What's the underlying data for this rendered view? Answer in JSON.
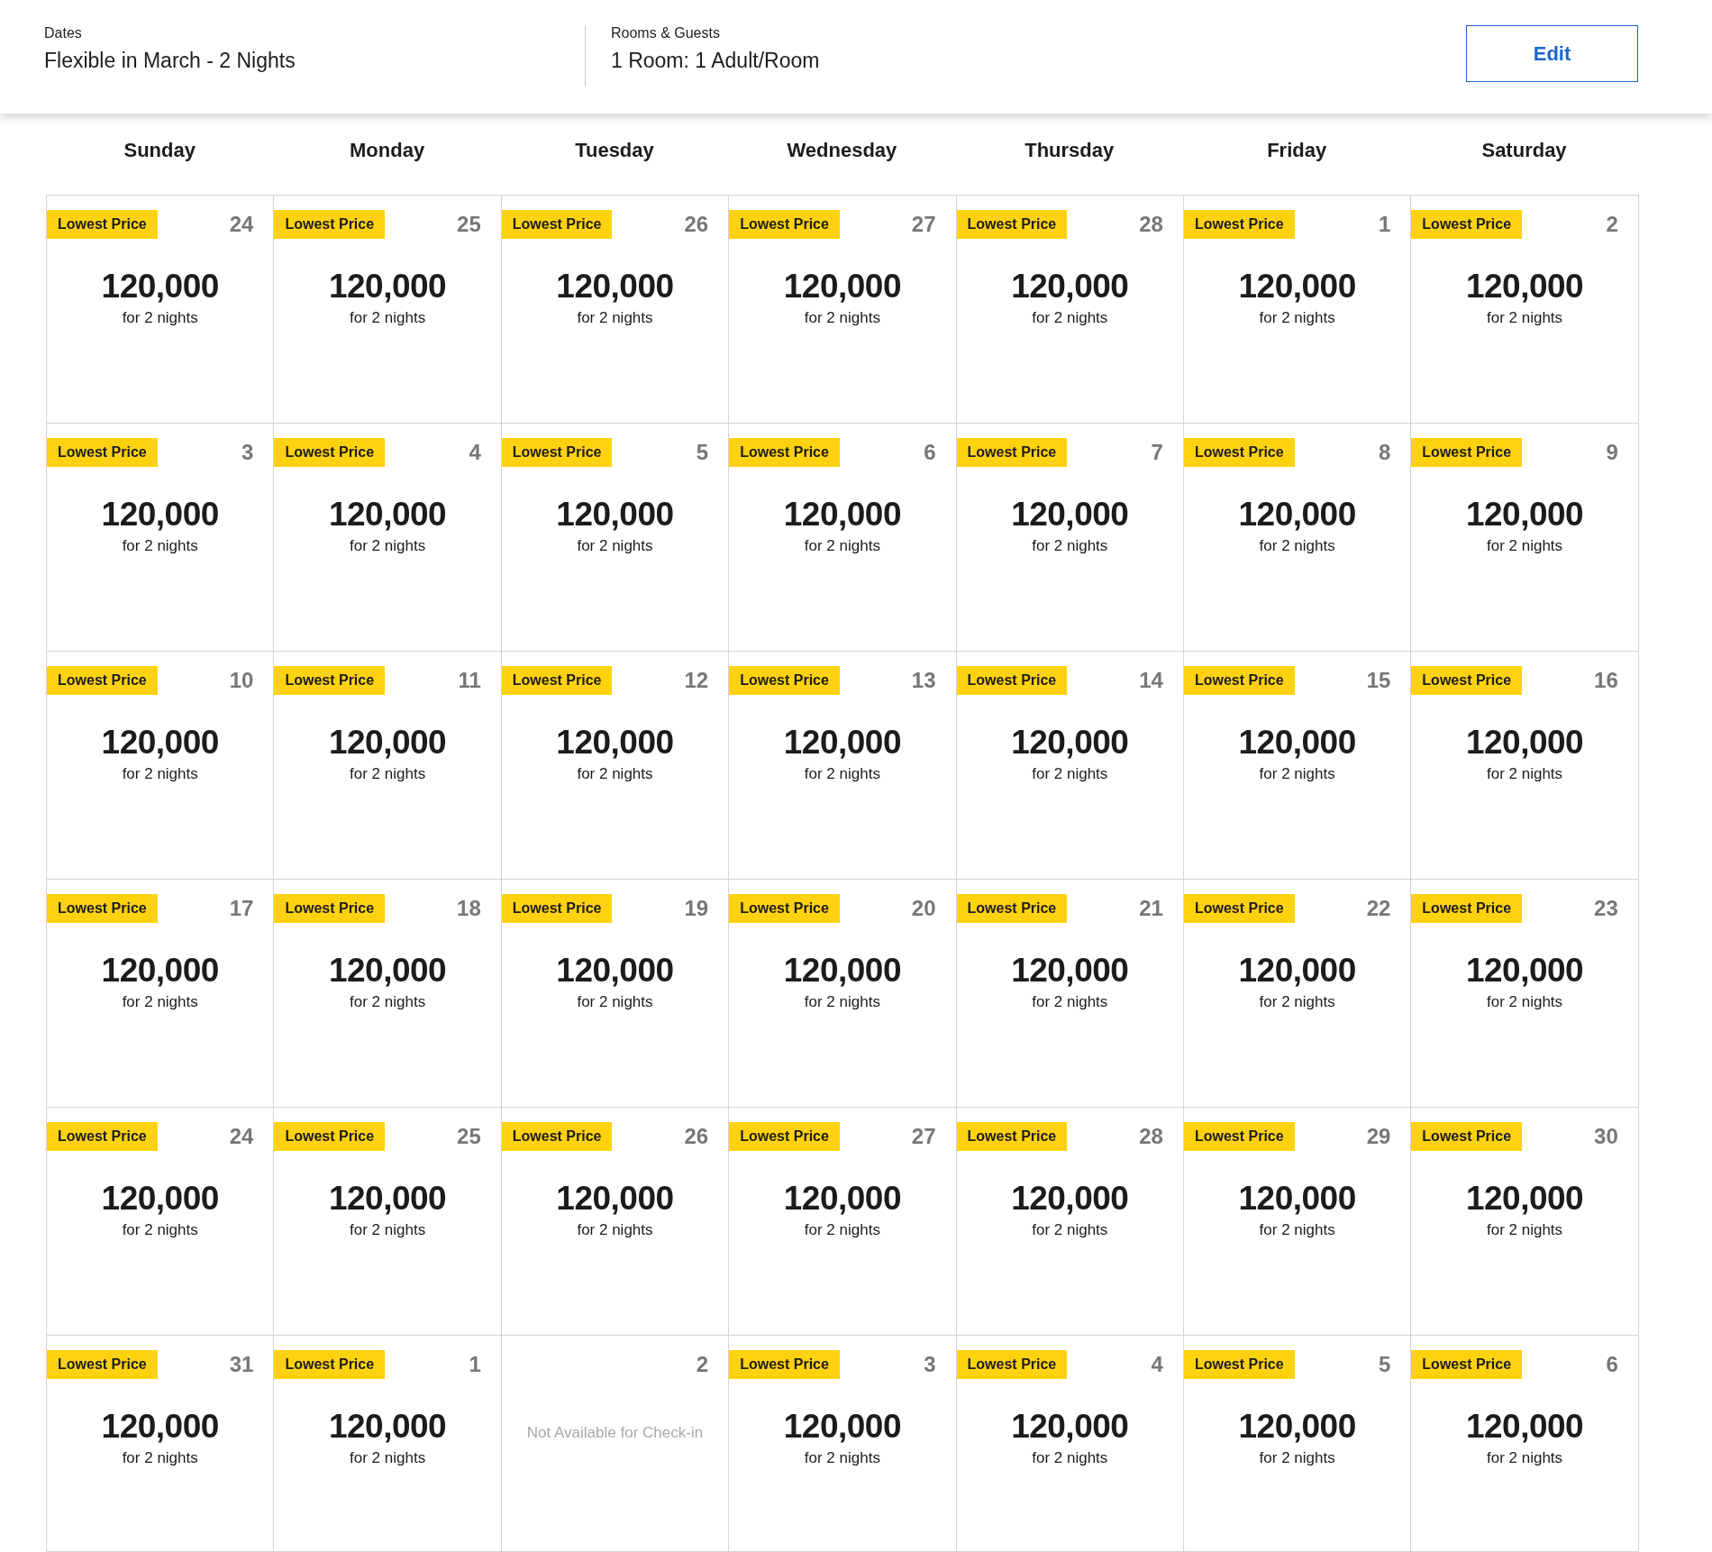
{
  "search_summary": [
    {
      "label": "Dates",
      "value": "Flexible in March - 2 Nights"
    },
    {
      "label": "Rooms & Guests",
      "value": "1 Room: 1 Adult/Room"
    }
  ],
  "edit_button": "Edit",
  "weekdays": [
    "Sunday",
    "Monday",
    "Tuesday",
    "Wednesday",
    "Thursday",
    "Friday",
    "Saturday"
  ],
  "days": [
    {
      "kind": "price",
      "badge": "Lowest Price",
      "date": "24",
      "price": "120,000",
      "nights": "for 2 nights"
    },
    {
      "kind": "price",
      "badge": "Lowest Price",
      "date": "25",
      "price": "120,000",
      "nights": "for 2 nights"
    },
    {
      "kind": "price",
      "badge": "Lowest Price",
      "date": "26",
      "price": "120,000",
      "nights": "for 2 nights"
    },
    {
      "kind": "price",
      "badge": "Lowest Price",
      "date": "27",
      "price": "120,000",
      "nights": "for 2 nights"
    },
    {
      "kind": "price",
      "badge": "Lowest Price",
      "date": "28",
      "price": "120,000",
      "nights": "for 2 nights"
    },
    {
      "kind": "price",
      "badge": "Lowest Price",
      "date": "1",
      "price": "120,000",
      "nights": "for 2 nights"
    },
    {
      "kind": "price",
      "badge": "Lowest Price",
      "date": "2",
      "price": "120,000",
      "nights": "for 2 nights"
    },
    {
      "kind": "price",
      "badge": "Lowest Price",
      "date": "3",
      "price": "120,000",
      "nights": "for 2 nights"
    },
    {
      "kind": "price",
      "badge": "Lowest Price",
      "date": "4",
      "price": "120,000",
      "nights": "for 2 nights"
    },
    {
      "kind": "price",
      "badge": "Lowest Price",
      "date": "5",
      "price": "120,000",
      "nights": "for 2 nights"
    },
    {
      "kind": "price",
      "badge": "Lowest Price",
      "date": "6",
      "price": "120,000",
      "nights": "for 2 nights"
    },
    {
      "kind": "price",
      "badge": "Lowest Price",
      "date": "7",
      "price": "120,000",
      "nights": "for 2 nights"
    },
    {
      "kind": "price",
      "badge": "Lowest Price",
      "date": "8",
      "price": "120,000",
      "nights": "for 2 nights"
    },
    {
      "kind": "price",
      "badge": "Lowest Price",
      "date": "9",
      "price": "120,000",
      "nights": "for 2 nights"
    },
    {
      "kind": "price",
      "badge": "Lowest Price",
      "date": "10",
      "price": "120,000",
      "nights": "for 2 nights"
    },
    {
      "kind": "price",
      "badge": "Lowest Price",
      "date": "11",
      "price": "120,000",
      "nights": "for 2 nights"
    },
    {
      "kind": "price",
      "badge": "Lowest Price",
      "date": "12",
      "price": "120,000",
      "nights": "for 2 nights"
    },
    {
      "kind": "price",
      "badge": "Lowest Price",
      "date": "13",
      "price": "120,000",
      "nights": "for 2 nights"
    },
    {
      "kind": "price",
      "badge": "Lowest Price",
      "date": "14",
      "price": "120,000",
      "nights": "for 2 nights"
    },
    {
      "kind": "price",
      "badge": "Lowest Price",
      "date": "15",
      "price": "120,000",
      "nights": "for 2 nights"
    },
    {
      "kind": "price",
      "badge": "Lowest Price",
      "date": "16",
      "price": "120,000",
      "nights": "for 2 nights"
    },
    {
      "kind": "price",
      "badge": "Lowest Price",
      "date": "17",
      "price": "120,000",
      "nights": "for 2 nights"
    },
    {
      "kind": "price",
      "badge": "Lowest Price",
      "date": "18",
      "price": "120,000",
      "nights": "for 2 nights"
    },
    {
      "kind": "price",
      "badge": "Lowest Price",
      "date": "19",
      "price": "120,000",
      "nights": "for 2 nights"
    },
    {
      "kind": "price",
      "badge": "Lowest Price",
      "date": "20",
      "price": "120,000",
      "nights": "for 2 nights"
    },
    {
      "kind": "price",
      "badge": "Lowest Price",
      "date": "21",
      "price": "120,000",
      "nights": "for 2 nights"
    },
    {
      "kind": "price",
      "badge": "Lowest Price",
      "date": "22",
      "price": "120,000",
      "nights": "for 2 nights"
    },
    {
      "kind": "price",
      "badge": "Lowest Price",
      "date": "23",
      "price": "120,000",
      "nights": "for 2 nights"
    },
    {
      "kind": "price",
      "badge": "Lowest Price",
      "date": "24",
      "price": "120,000",
      "nights": "for 2 nights"
    },
    {
      "kind": "price",
      "badge": "Lowest Price",
      "date": "25",
      "price": "120,000",
      "nights": "for 2 nights"
    },
    {
      "kind": "price",
      "badge": "Lowest Price",
      "date": "26",
      "price": "120,000",
      "nights": "for 2 nights"
    },
    {
      "kind": "price",
      "badge": "Lowest Price",
      "date": "27",
      "price": "120,000",
      "nights": "for 2 nights"
    },
    {
      "kind": "price",
      "badge": "Lowest Price",
      "date": "28",
      "price": "120,000",
      "nights": "for 2 nights"
    },
    {
      "kind": "price",
      "badge": "Lowest Price",
      "date": "29",
      "price": "120,000",
      "nights": "for 2 nights"
    },
    {
      "kind": "price",
      "badge": "Lowest Price",
      "date": "30",
      "price": "120,000",
      "nights": "for 2 nights"
    },
    {
      "kind": "price",
      "badge": "Lowest Price",
      "date": "31",
      "price": "120,000",
      "nights": "for 2 nights"
    },
    {
      "kind": "price",
      "badge": "Lowest Price",
      "date": "1",
      "price": "120,000",
      "nights": "for 2 nights"
    },
    {
      "kind": "unavailable",
      "date": "2",
      "note": "Not Available for Check-in"
    },
    {
      "kind": "price",
      "badge": "Lowest Price",
      "date": "3",
      "price": "120,000",
      "nights": "for 2 nights"
    },
    {
      "kind": "price",
      "badge": "Lowest Price",
      "date": "4",
      "price": "120,000",
      "nights": "for 2 nights"
    },
    {
      "kind": "price",
      "badge": "Lowest Price",
      "date": "5",
      "price": "120,000",
      "nights": "for 2 nights"
    },
    {
      "kind": "price",
      "badge": "Lowest Price",
      "date": "6",
      "price": "120,000",
      "nights": "for 2 nights"
    }
  ]
}
